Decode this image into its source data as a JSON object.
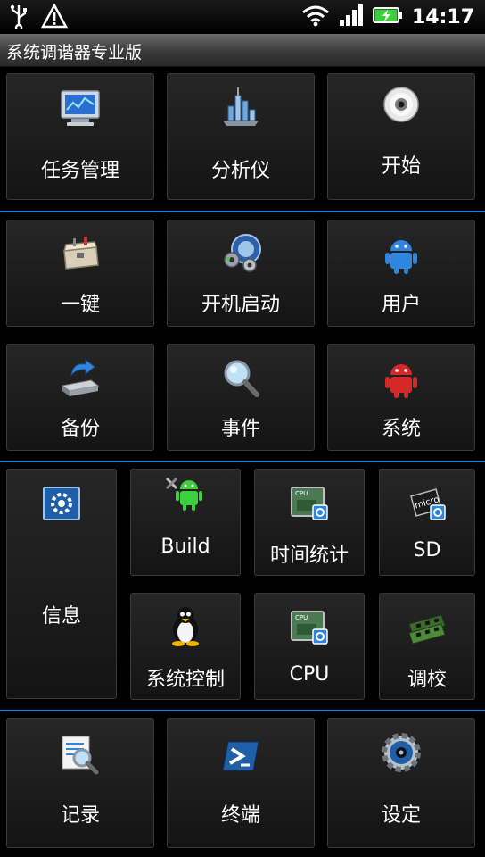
{
  "status_bar": {
    "time": "14:17",
    "icons": [
      "usb-icon",
      "warning-icon",
      "wifi-icon",
      "signal-icon",
      "battery-charging-icon"
    ]
  },
  "app": {
    "title": "系统调谐器专业版"
  },
  "accent_color": "#2a7fd4",
  "tiles": {
    "task_manager": {
      "label": "任务管理",
      "icon": "monitor-icon"
    },
    "analyzer": {
      "label": "分析仪",
      "icon": "bar-chart-icon"
    },
    "start": {
      "label": "开始",
      "icon": "disc-icon"
    },
    "one_key": {
      "label": "一键",
      "icon": "toolbox-icon"
    },
    "boot_start": {
      "label": "开机启动",
      "icon": "gears-icon"
    },
    "user": {
      "label": "用户",
      "icon": "android-blue-icon"
    },
    "backup": {
      "label": "备份",
      "icon": "backup-drive-icon"
    },
    "event": {
      "label": "事件",
      "icon": "magnifier-icon"
    },
    "system": {
      "label": "系统",
      "icon": "android-red-icon"
    },
    "info": {
      "label": "信息",
      "icon": "settings-window-icon"
    },
    "build": {
      "label": "Build",
      "icon": "android-tools-icon"
    },
    "time_stats": {
      "label": "时间统计",
      "icon": "cpu-chip-icon"
    },
    "sd": {
      "label": "SD",
      "icon": "sd-card-icon"
    },
    "system_control": {
      "label": "系统控制",
      "icon": "penguin-icon"
    },
    "cpu": {
      "label": "CPU",
      "icon": "cpu-chip-icon"
    },
    "tuning": {
      "label": "调校",
      "icon": "ram-icon"
    },
    "log": {
      "label": "记录",
      "icon": "log-search-icon"
    },
    "terminal": {
      "label": "终端",
      "icon": "terminal-icon"
    },
    "settings": {
      "label": "设定",
      "icon": "gear-icon"
    }
  }
}
